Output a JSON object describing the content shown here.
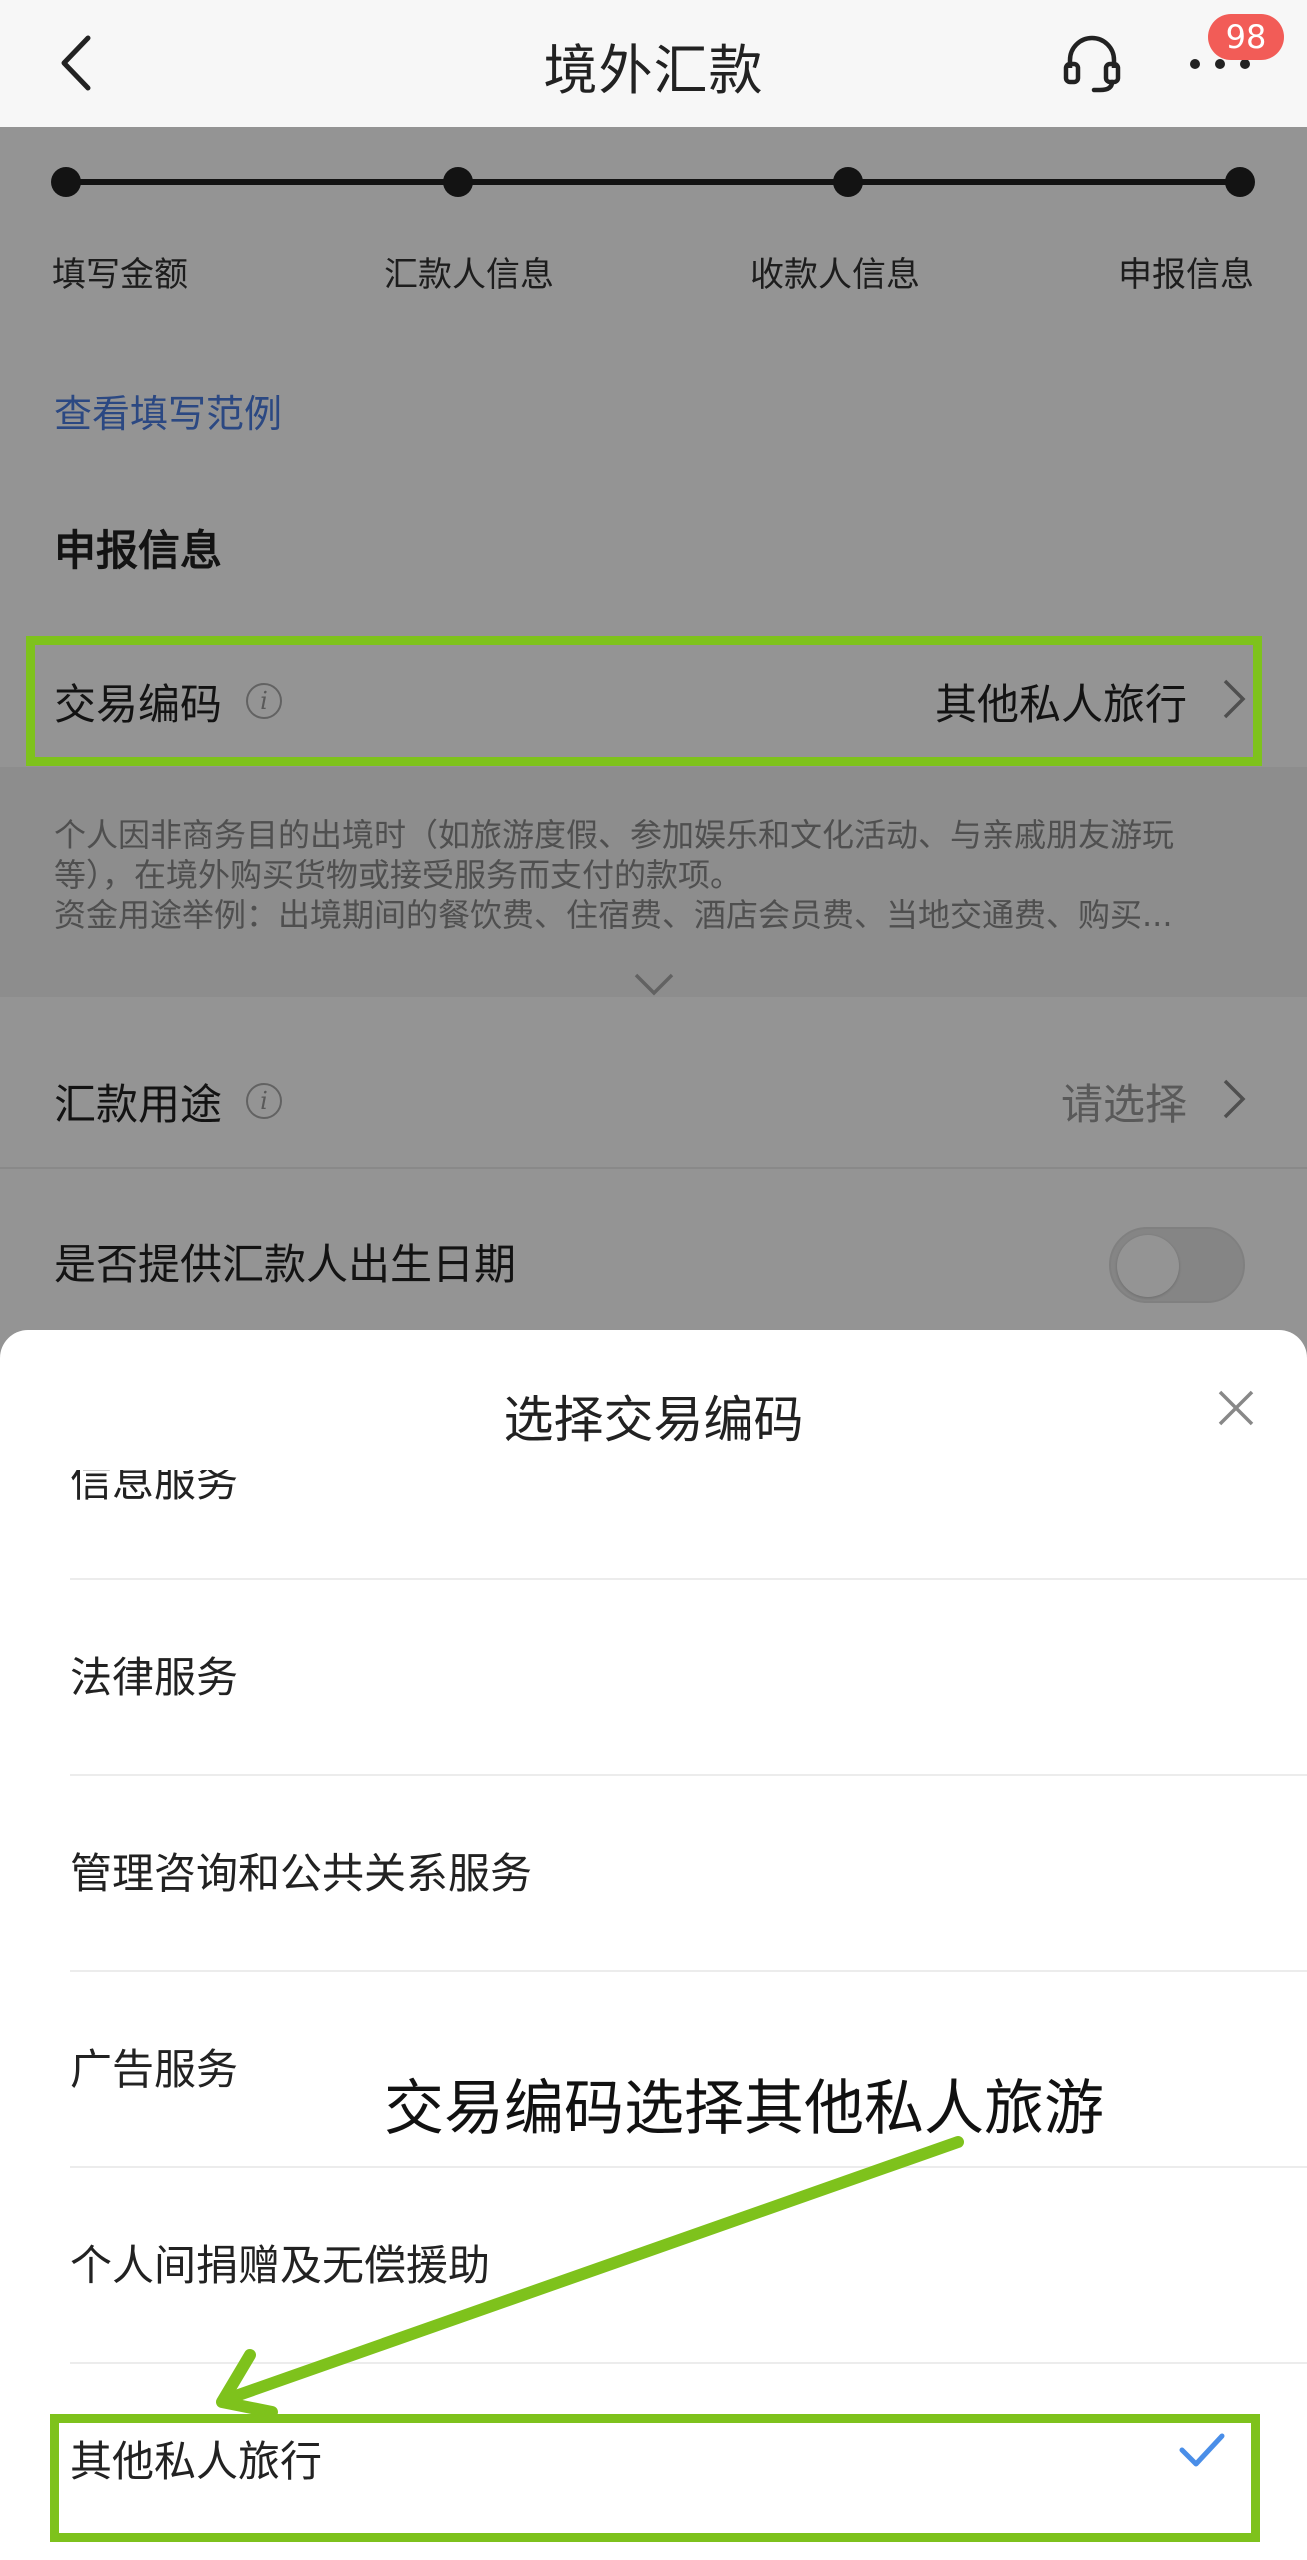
{
  "header": {
    "title": "境外汇款",
    "badge_count": "98",
    "icons": {
      "back": "chevron-left-icon",
      "service": "headset-icon",
      "more": "more-dots-icon"
    }
  },
  "steps": [
    {
      "label": "填写金额"
    },
    {
      "label": "汇款人信息"
    },
    {
      "label": "收款人信息"
    },
    {
      "label": "申报信息"
    }
  ],
  "example_link": "查看填写范例",
  "declaration": {
    "section_title": "申报信息",
    "transaction_code": {
      "label": "交易编码",
      "value": "其他私人旅行"
    },
    "description_lines": [
      "个人因非商务目的出境时（如旅游度假、参加娱乐和文化活动、与亲戚朋友游玩",
      "等），在境外购买货物或接受服务而支付的款项。",
      "资金用途举例：出境期间的餐饮费、住宿费、酒店会员费、当地交通费、购买..."
    ],
    "purpose": {
      "label": "汇款用途",
      "value": "请选择"
    },
    "birth_date_toggle": {
      "label": "是否提供汇款人出生日期",
      "checked": false
    }
  },
  "sheet": {
    "title": "选择交易编码",
    "items": [
      {
        "label": "信息服务",
        "selected": false
      },
      {
        "label": "法律服务",
        "selected": false
      },
      {
        "label": "管理咨询和公共关系服务",
        "selected": false
      },
      {
        "label": "广告服务",
        "selected": false
      },
      {
        "label": "个人间捐赠及无偿援助",
        "selected": false
      },
      {
        "label": "其他私人旅行",
        "selected": true
      }
    ]
  },
  "annotation": {
    "text": "交易编码选择其他私人旅游",
    "color": "#7ec21c"
  },
  "colors": {
    "link": "#4a7de0",
    "badge": "#f25c57",
    "check": "#4a8ee8"
  }
}
